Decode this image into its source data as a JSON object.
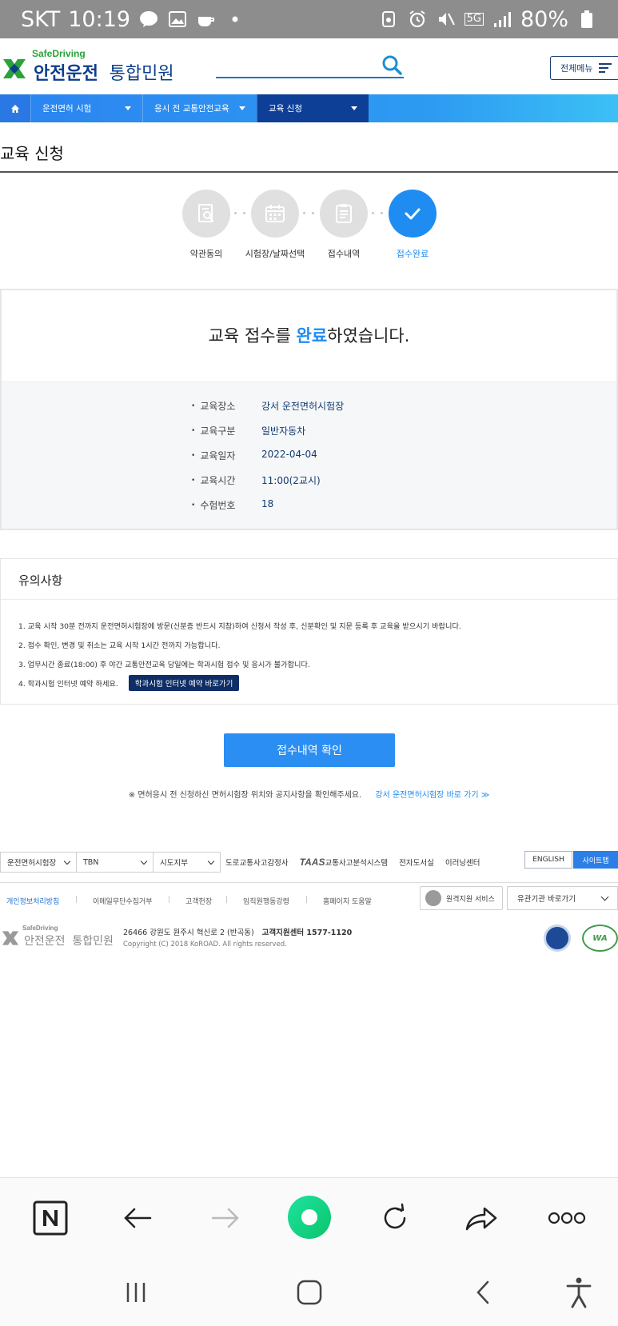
{
  "status_bar": {
    "carrier": "SKT",
    "time": "10:19",
    "network": "5G",
    "battery": "80%"
  },
  "header": {
    "logo_en": "SafeDriving",
    "logo_ko_bold": "안전운전",
    "logo_ko_normal": "통합민원",
    "menu_label": "전체메뉴"
  },
  "nav": {
    "items": [
      {
        "label": "운전면허 시험"
      },
      {
        "label": "응시 전 교통안전교육"
      },
      {
        "label": "교육 신청"
      }
    ]
  },
  "page": {
    "title": "교육 신청"
  },
  "steps": [
    {
      "label": "약관동의",
      "icon": "search-document-icon",
      "done": false
    },
    {
      "label": "시험장/날짜선택",
      "icon": "calendar-icon",
      "done": false
    },
    {
      "label": "접수내역",
      "icon": "clipboard-icon",
      "done": false
    },
    {
      "label": "접수완료",
      "icon": "check-icon",
      "done": true
    }
  ],
  "result": {
    "message_pre": "교육 접수를 ",
    "message_highlight": "완료",
    "message_post": "하였습니다.",
    "details": [
      {
        "key": "교육장소",
        "value": "강서 운전면허시험장"
      },
      {
        "key": "교육구분",
        "value": "일반자동차"
      },
      {
        "key": "교육일자",
        "value": "2022-04-04"
      },
      {
        "key": "교육시간",
        "value": "11:00(2교시)"
      },
      {
        "key": "수험번호",
        "value": "18"
      }
    ]
  },
  "notice": {
    "title": "유의사항",
    "items": [
      "1. 교육 시작 30분 전까지 운전면허시험장에 방문(신분증 반드시 지참)하여 신청서 작성 후, 신분확인 및 지문 등록 후 교육을 받으시기 바랍니다.",
      "2. 접수 확인, 변경 및 취소는 교육 시작 1시간 전까지 가능합니다.",
      "3. 업무시간 종료(18:00) 후 야간 교통안전교육 당일에는 학과시험 접수 및 응시가 불가합니다.",
      "4. 학과시험 인터넷 예약 하세요."
    ],
    "shortcut_button": "학과시험 인터넷 예약 바로가기"
  },
  "main_button": "접수내역 확인",
  "hint": {
    "text": "※ 면허응시 전 신청하신 면허시험장 위치와 공지사항을 확인해주세요.",
    "link": "강서 운전면허시험장 바로 가기 ≫"
  },
  "footer": {
    "selects": [
      "운전면허시험장",
      "TBN",
      "시도지부"
    ],
    "links": [
      "도로교통사고감정사",
      "TAAS",
      "교통사고분석시스템",
      "전자도서실",
      "이러닝센터"
    ],
    "english": "ENGLISH",
    "sitemap": "사이트맵",
    "policy_links": [
      "개인정보처리방침",
      "이메일무단수집거부",
      "고객헌장",
      "임직원행동강령",
      "홈페이지 도움말"
    ],
    "remote_support": "원격지원 서비스",
    "related": "유관기관 바로가기",
    "logo_en": "SafeDriving",
    "logo_ko_bold": "안전운전",
    "logo_ko_normal": "통합민원",
    "address": "26466 강원도 원주시 혁신로 2 (반곡동)",
    "call_center": "고객지원센터 1577-1120",
    "copyright": "Copyright (C) 2018 KoROAD. All rights reserved.",
    "badge_wa": "WA"
  },
  "colors": {
    "accent": "#1f8cf2",
    "nav_active": "#0e3f96",
    "logo_green": "#2aa33a",
    "logo_navy": "#0c3e8c"
  }
}
